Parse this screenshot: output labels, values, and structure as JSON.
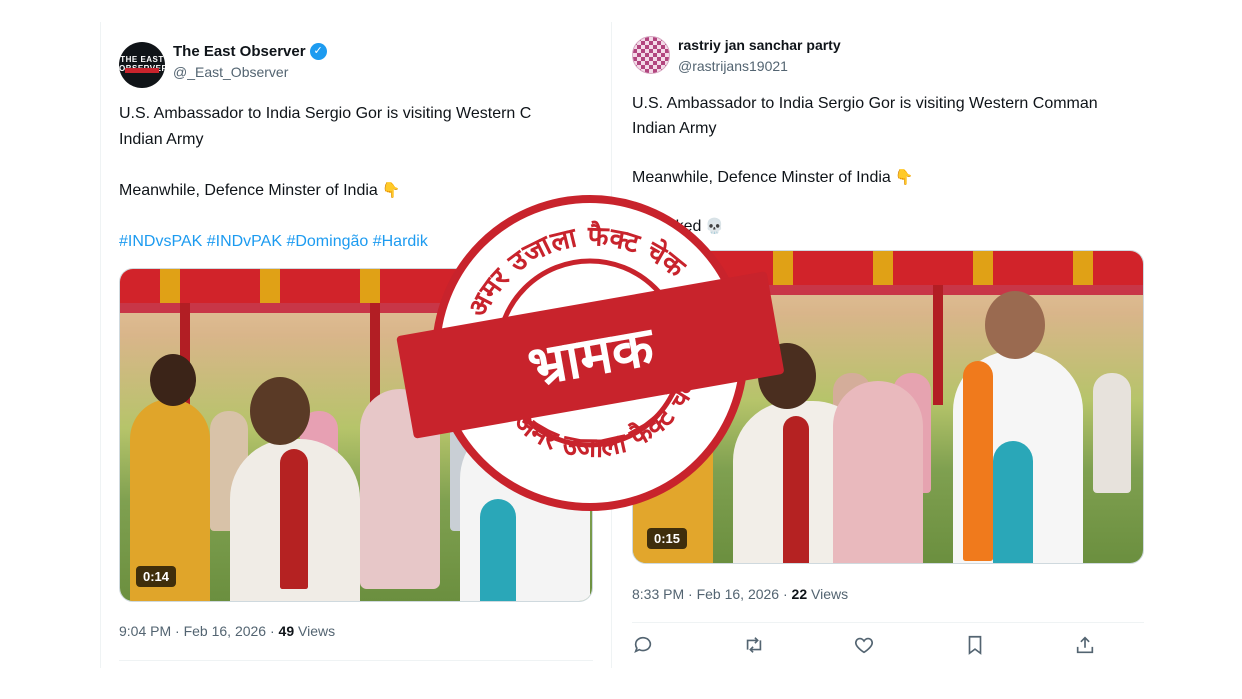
{
  "left_tweet": {
    "display_name": "The East Observer",
    "handle": "@_East_Observer",
    "avatar_text": "THE EAST OBSERVER",
    "text_line1": "U.S. Ambassador to India Sergio Gor is visiting Western C",
    "text_line2": "Indian Army",
    "text_line3": "Meanwhile, Defence Minster of India",
    "hashtags": "#INDvsPAK #INDvPAK #Domingão #Hardik",
    "video_duration": "0:14",
    "timestamp": "9:04 PM · Feb 16, 2026 · ",
    "views_count": "49",
    "views_label": " Views",
    "pointing_emoji": "👇"
  },
  "right_tweet": {
    "display_name": "rastriy jan sanchar party",
    "handle": "@rastrijans19021",
    "text_line1": "U.S. Ambassador to India Sergio Gor is visiting Western Comman",
    "text_line2": "Indian Army",
    "text_line3": "Meanwhile, Defence Minster of India",
    "text_line4": "... cooked",
    "skull_emoji": "💀",
    "pointing_emoji": "👇",
    "video_duration": "0:15",
    "timestamp": "8:33 PM · Feb 16, 2026 · ",
    "views_count": "22",
    "views_label": " Views",
    "actions": [
      "reply-icon",
      "retweet-icon",
      "like-icon",
      "bookmark-icon",
      "share-icon"
    ]
  },
  "stamp": {
    "top_arc": "अमर उजाला फैक्ट चेक",
    "main_label": "भ्रामक",
    "bottom_arc": "अमर उजाला फैक्ट चेक",
    "color": "#c8232c"
  },
  "colors": {
    "link_blue": "#1d9bf0",
    "muted_text": "#536471",
    "verified_badge": "#1d9bf0"
  }
}
